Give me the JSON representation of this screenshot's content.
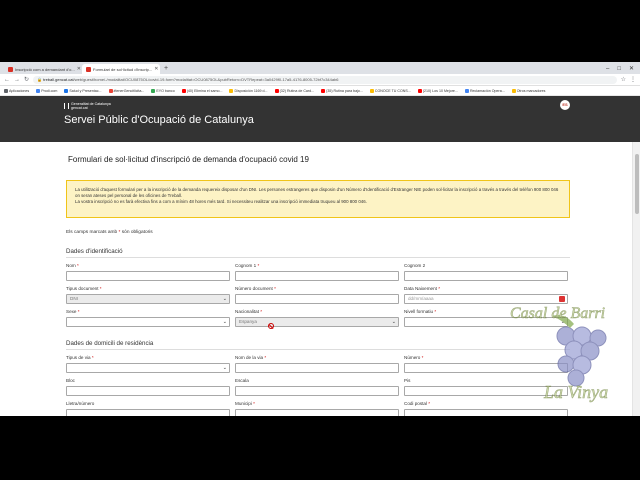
{
  "browser": {
    "tabs": [
      {
        "title": "Inscripció com a demandant d'o...",
        "active": false
      },
      {
        "title": "Formulari de sol·licitud d'inscrip...",
        "active": true
      }
    ],
    "new_tab": "+",
    "window_controls": [
      "–",
      "□",
      "✕"
    ],
    "url_host": "treball.gencat.cat",
    "url_rest": "/web/guest/home/-/modalitat/OCU0875OL/covid-19-form?modalitat=OCU0875OL&pubRetorn=DVTRepeat=3a0429f0-17a5-4176-8005-72bf7c344ab6",
    "nav_icons": [
      "back-icon",
      "forward-icon",
      "reload-icon"
    ],
    "bookmarks": [
      {
        "label": "Aplicaciones",
        "color": "#5f6368"
      },
      {
        "label": "Prodi.com",
        "color": "#4285f4"
      },
      {
        "label": "Salud y Presentac...",
        "color": "#1a73e8"
      },
      {
        "label": "#tenerGencitlicita...",
        "color": "#ea4335"
      },
      {
        "label": "EYO banco",
        "color": "#34a853"
      },
      {
        "label": "(40) Elimina el samo...",
        "color": "#ff0000"
      },
      {
        "label": "Disposición 1169 d...",
        "color": "#fbbc04"
      },
      {
        "label": "(32) Rutina de Card...",
        "color": "#ff0000"
      },
      {
        "label": "(35) Rutina para bajo...",
        "color": "#ff0000"
      },
      {
        "label": "CONOCE TU CONS...",
        "color": "#fbbc04"
      },
      {
        "label": "(210) Los 10 Mejore...",
        "color": "#ff0000"
      },
      {
        "label": "Reclamación Opera...",
        "color": "#4285f4"
      },
      {
        "label": "Otros marcadores",
        "color": "#fbbc04"
      }
    ]
  },
  "site": {
    "logo_line1": "Generalitat de Catalunya",
    "logo_line2": "gencat.cat",
    "title": "Servei Públic d'Ocupació de Catalunya",
    "user_initials": "ES"
  },
  "form": {
    "title": "Formulari de sol·licitud d'inscripció de demanda d'ocupació covid 19",
    "notice_1": "La utilització d'aquest formulari per a la inscripció de la demanda requereix disposar d'un DNI. Les persones estrangeres que disposin d'un Número d'Identificació d'Estranger NIE poden sol·licitar la inscripció a través a través del telèfon 900 800 046 on seran ateses pel personal de les oficines de Treball.",
    "notice_2": "La vostra inscripció no es farà efectiva fins a com a mínim 48 hores més tard. Si necessiteu realitzar una inscripció immediata truqueu al 900 800 046.",
    "required_note": "Els camps marcats amb",
    "required_note_ast": "*",
    "required_note_end": "són obligatoris",
    "section_personal": "Dades d'identificació",
    "section_address": "Dades de domicili de residència",
    "labels": {
      "nom": "Nom",
      "cognom1": "Cognom 1",
      "cognom2": "Cognom 2",
      "tipus_document": "Tipus document",
      "numero_document": "Número document",
      "data_naixement": "Data Naixement",
      "sexe": "Sexe",
      "nacionalitat": "Nacionalitat",
      "nivell_formatiu": "Nivell formatiu",
      "tipus_via": "Tipus de via",
      "nom_via": "Nom de la via",
      "numero": "Número",
      "bloc": "Bloc",
      "escala": "Escala",
      "pis": "Pis",
      "lletra_numero": "Lletra/número",
      "municipi": "Municipi",
      "codi_postal": "Codi postal"
    },
    "asterisk": "*",
    "values": {
      "tipus_document": "DNI",
      "data_naixement_placeholder": "dd/mm/aaaa",
      "nacionalitat": "Espanya"
    }
  },
  "watermark": {
    "line1": "Casal de Barri",
    "line2": "La Vinya"
  },
  "colors": {
    "header_bg": "#333333",
    "notice_bg": "#fdf3c5",
    "notice_border": "#f0c419",
    "required": "#cc0000"
  }
}
